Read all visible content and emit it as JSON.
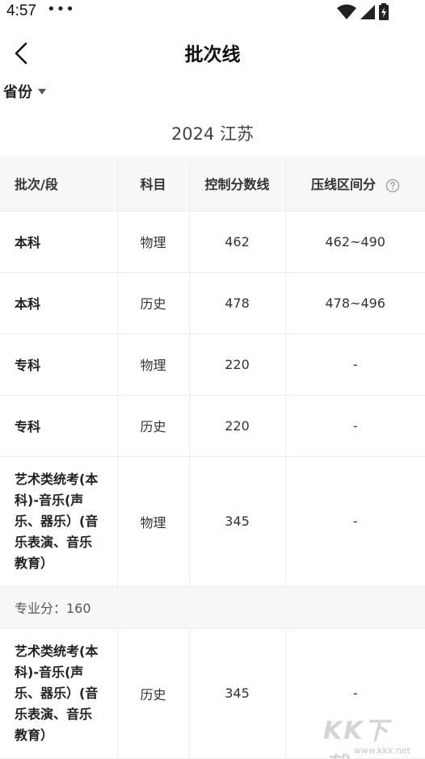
{
  "status_bar": {
    "time": "4:57",
    "more": "•••",
    "icons": [
      "wifi-icon",
      "signal-icon",
      "battery-charging-icon"
    ]
  },
  "nav": {
    "title": "批次线",
    "back_icon": "chevron-left-icon"
  },
  "filter": {
    "province_label": "省份",
    "dropdown_icon": "caret-down-icon"
  },
  "year_region": "2024 江苏",
  "table": {
    "headers": [
      "批次/段",
      "科目",
      "控制分数线",
      "压线区间分"
    ],
    "header_help_icon": "question-circle-icon",
    "rows": [
      {
        "batch": "本科",
        "subject": "物理",
        "score": "462",
        "range": "462~490"
      },
      {
        "batch": "本科",
        "subject": "历史",
        "score": "478",
        "range": "478~496"
      },
      {
        "batch": "专科",
        "subject": "物理",
        "score": "220",
        "range": "-"
      },
      {
        "batch": "专科",
        "subject": "历史",
        "score": "220",
        "range": "-"
      },
      {
        "batch_lines": [
          "艺术类统考(本",
          "科)-音乐(声",
          "乐、器乐）(音",
          "乐表演、音乐",
          "教育）"
        ],
        "subject": "物理",
        "score": "345",
        "range": "-"
      },
      {
        "batch_lines": [
          "艺术类统考(本",
          "科)-音乐(声",
          "乐、器乐）(音",
          "乐表演、音乐",
          "教育）"
        ],
        "subject": "历史",
        "score": "345",
        "range": "-"
      }
    ],
    "note": "专业分：160"
  },
  "watermark": {
    "logo": "KK下载",
    "url": "www.kkx.net"
  },
  "colors": {
    "header_bg": "#f7f7f7",
    "border": "#ececec",
    "text": "#222222"
  }
}
